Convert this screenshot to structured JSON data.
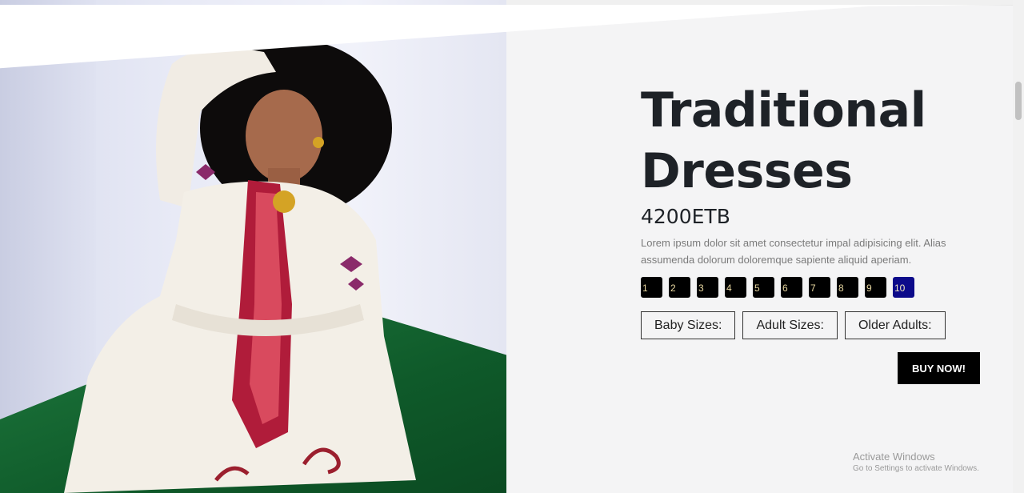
{
  "product": {
    "title": "Traditional Dresses",
    "price": "4200ETB",
    "description": "Lorem ipsum dolor sit amet consectetur impal adipisicing elit. Alias assumenda dolorum doloremque sapiente aliquid aperiam."
  },
  "numbers": [
    "1",
    "2",
    "3",
    "4",
    "5",
    "6",
    "7",
    "8",
    "9",
    "10"
  ],
  "active_number": "10",
  "sizes": {
    "baby": "Baby Sizes:",
    "adult": "Adult Sizes:",
    "older": "Older Adults:"
  },
  "buy_label": "BUY NOW!",
  "watermark": {
    "line1": "Activate Windows",
    "line2": "Go to Settings to activate Windows."
  },
  "colors": {
    "active_number_bg": "#0c0a8a",
    "number_bg": "#000000",
    "buy_bg": "#000000"
  }
}
